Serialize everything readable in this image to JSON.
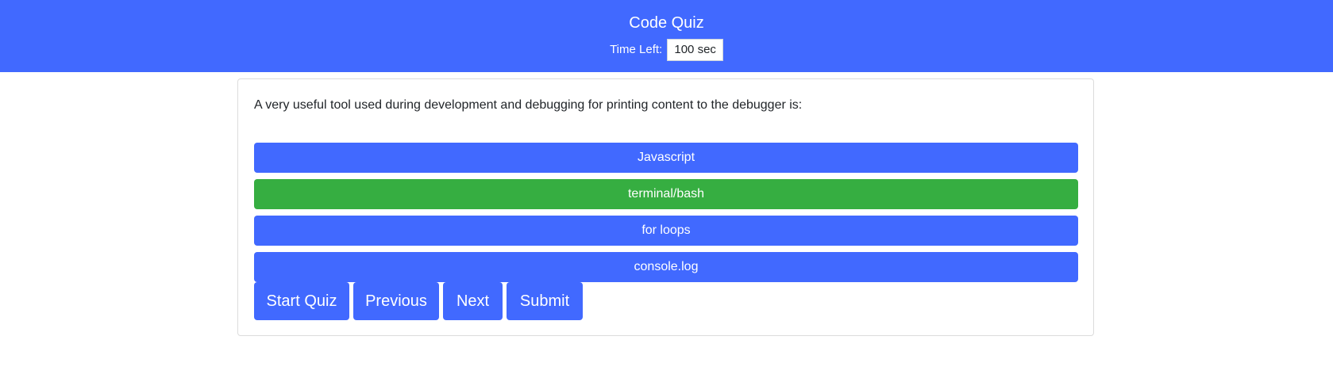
{
  "header": {
    "title": "Code Quiz",
    "time_label": "Time Left:",
    "time_value": "100 sec"
  },
  "colors": {
    "primary": "#4169ff",
    "correct": "#36ae41",
    "text": "#212529"
  },
  "quiz": {
    "question": "A very useful tool used during development and debugging for printing content to the debugger is:",
    "answers": [
      {
        "label": "Javascript",
        "state": "default"
      },
      {
        "label": "terminal/bash",
        "state": "highlighted"
      },
      {
        "label": "for loops",
        "state": "default"
      },
      {
        "label": "console.log",
        "state": "default"
      }
    ]
  },
  "controls": {
    "start_label": "Start Quiz",
    "previous_label": "Previous",
    "next_label": "Next",
    "submit_label": "Submit"
  }
}
